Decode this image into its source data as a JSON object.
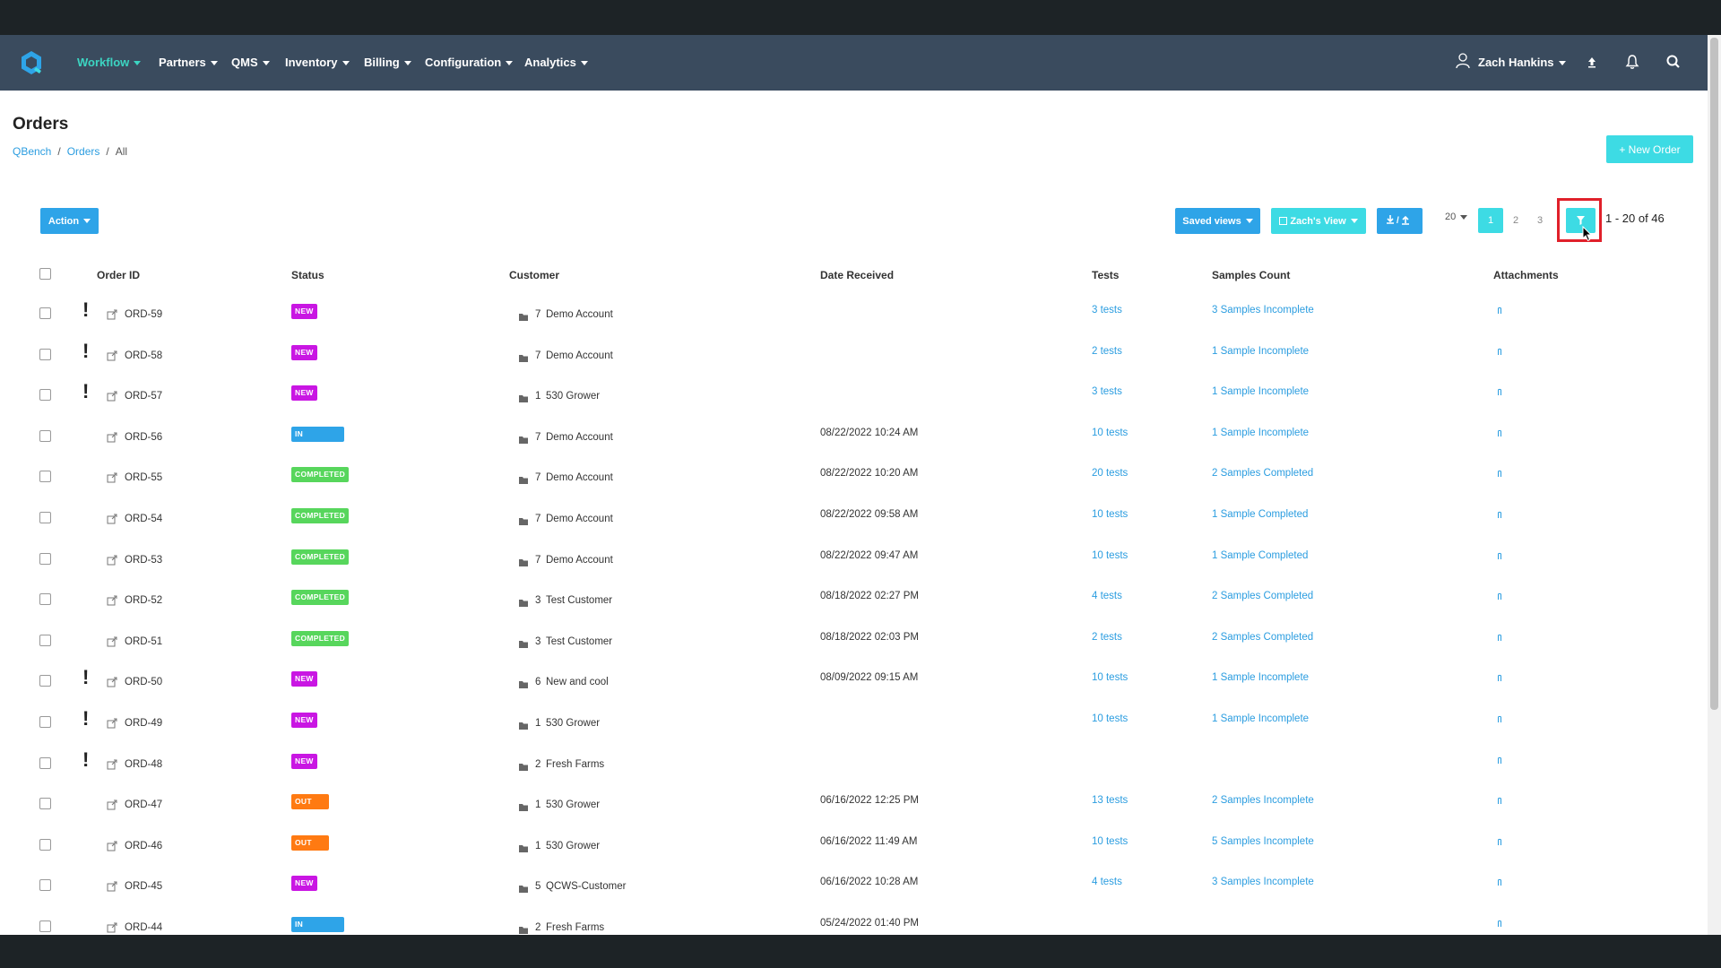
{
  "nav": {
    "items": [
      {
        "label": "Workflow",
        "active": true
      },
      {
        "label": "Partners"
      },
      {
        "label": "QMS"
      },
      {
        "label": "Inventory"
      },
      {
        "label": "Billing"
      },
      {
        "label": "Configuration"
      },
      {
        "label": "Analytics"
      }
    ],
    "user": "Zach Hankins",
    "icons": [
      "user-icon",
      "upload-icon",
      "bell-icon",
      "search-icon"
    ]
  },
  "page": {
    "title": "Orders",
    "breadcrumb": [
      "QBench",
      "Orders",
      "All"
    ],
    "new_order_label": "+ New Order"
  },
  "toolbar": {
    "action_label": "Action",
    "saved_views_label": "Saved views",
    "view_label": "Zach's View",
    "per_page": "20",
    "pages": [
      "1",
      "2",
      "3"
    ],
    "current_page": "1",
    "range_text": "1 - 20 of 46"
  },
  "table": {
    "headers": [
      "Order ID",
      "Status",
      "Customer",
      "Date Received",
      "Tests",
      "Samples Count",
      "Attachments"
    ],
    "rows": [
      {
        "priority": true,
        "id": "ORD-59",
        "status": "NEW",
        "status_type": "new",
        "customer_num": "7",
        "customer": "Demo Account",
        "date": "",
        "tests": "3 tests",
        "samples": "3 Samples Incomplete"
      },
      {
        "priority": true,
        "id": "ORD-58",
        "status": "NEW",
        "status_type": "new",
        "customer_num": "7",
        "customer": "Demo Account",
        "date": "",
        "tests": "2 tests",
        "samples": "1 Sample Incomplete"
      },
      {
        "priority": true,
        "id": "ORD-57",
        "status": "NEW",
        "status_type": "new",
        "customer_num": "1",
        "customer": "530 Grower",
        "date": "",
        "tests": "3 tests",
        "samples": "1 Sample Incomplete"
      },
      {
        "priority": false,
        "id": "ORD-56",
        "status": "IN PROGRESS",
        "status_type": "inprogress",
        "customer_num": "7",
        "customer": "Demo Account",
        "date": "08/22/2022 10:24 AM",
        "tests": "10 tests",
        "samples": "1 Sample Incomplete"
      },
      {
        "priority": false,
        "id": "ORD-55",
        "status": "COMPLETED",
        "status_type": "completed",
        "customer_num": "7",
        "customer": "Demo Account",
        "date": "08/22/2022 10:20 AM",
        "tests": "20 tests",
        "samples": "2 Samples Completed"
      },
      {
        "priority": false,
        "id": "ORD-54",
        "status": "COMPLETED",
        "status_type": "completed",
        "customer_num": "7",
        "customer": "Demo Account",
        "date": "08/22/2022 09:58 AM",
        "tests": "10 tests",
        "samples": "1 Sample Completed"
      },
      {
        "priority": false,
        "id": "ORD-53",
        "status": "COMPLETED",
        "status_type": "completed",
        "customer_num": "7",
        "customer": "Demo Account",
        "date": "08/22/2022 09:47 AM",
        "tests": "10 tests",
        "samples": "1 Sample Completed"
      },
      {
        "priority": false,
        "id": "ORD-52",
        "status": "COMPLETED",
        "status_type": "completed",
        "customer_num": "3",
        "customer": "Test Customer",
        "date": "08/18/2022 02:27 PM",
        "tests": "4 tests",
        "samples": "2 Samples Completed"
      },
      {
        "priority": false,
        "id": "ORD-51",
        "status": "COMPLETED",
        "status_type": "completed",
        "customer_num": "3",
        "customer": "Test Customer",
        "date": "08/18/2022 02:03 PM",
        "tests": "2 tests",
        "samples": "2 Samples Completed"
      },
      {
        "priority": true,
        "id": "ORD-50",
        "status": "NEW",
        "status_type": "new",
        "customer_num": "6",
        "customer": "New and cool",
        "date": "08/09/2022 09:15 AM",
        "tests": "10 tests",
        "samples": "1 Sample Incomplete"
      },
      {
        "priority": true,
        "id": "ORD-49",
        "status": "NEW",
        "status_type": "new",
        "customer_num": "1",
        "customer": "530 Grower",
        "date": "",
        "tests": "10 tests",
        "samples": "1 Sample Incomplete"
      },
      {
        "priority": true,
        "id": "ORD-48",
        "status": "NEW",
        "status_type": "new",
        "customer_num": "2",
        "customer": "Fresh Farms",
        "date": "",
        "tests": "",
        "samples": ""
      },
      {
        "priority": false,
        "id": "ORD-47",
        "status": "OUT FOR PICKUP",
        "status_type": "pickup",
        "customer_num": "1",
        "customer": "530 Grower",
        "date": "06/16/2022 12:25 PM",
        "tests": "13 tests",
        "samples": "2 Samples Incomplete"
      },
      {
        "priority": false,
        "id": "ORD-46",
        "status": "OUT FOR PICKUP",
        "status_type": "pickup",
        "customer_num": "1",
        "customer": "530 Grower",
        "date": "06/16/2022 11:49 AM",
        "tests": "10 tests",
        "samples": "5 Samples Incomplete"
      },
      {
        "priority": false,
        "id": "ORD-45",
        "status": "NEW",
        "status_type": "new",
        "customer_num": "5",
        "customer": "QCWS-Customer",
        "date": "06/16/2022 10:28 AM",
        "tests": "4 tests",
        "samples": "3 Samples Incomplete"
      },
      {
        "priority": false,
        "id": "ORD-44",
        "status": "IN PROGRESS",
        "status_type": "inprogress",
        "customer_num": "2",
        "customer": "Fresh Farms",
        "date": "05/24/2022 01:40 PM",
        "tests": "",
        "samples": ""
      }
    ]
  },
  "colors": {
    "nav_bg": "#3a4b5e",
    "accent_teal": "#3ddbe4",
    "accent_blue": "#2ea4e8",
    "status_new": "#c916e3",
    "status_inprogress": "#2ea4e8",
    "status_completed": "#57d65c",
    "status_pickup": "#ff7a12"
  }
}
